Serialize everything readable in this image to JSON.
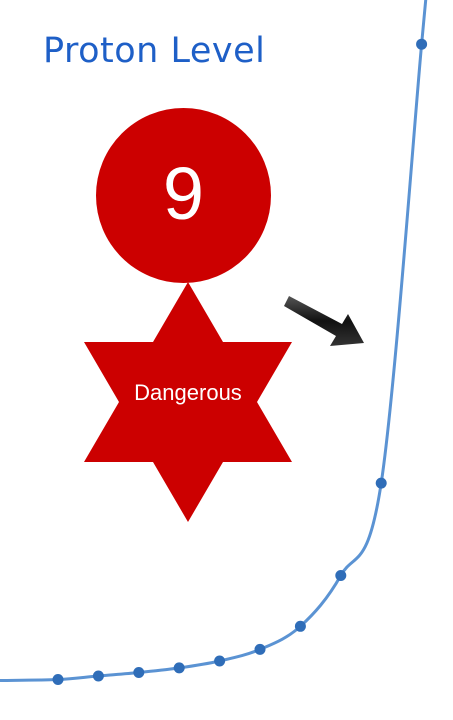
{
  "title": "Proton Level",
  "level": {
    "value": "9",
    "status": "Dangerous"
  },
  "colors": {
    "title": "#1e5fc7",
    "danger": "#cc0000",
    "curve": "#5b93d3",
    "point": "#2f6db8",
    "arrow": "#222222"
  },
  "icons": {
    "status_shape": "six-point-star-icon",
    "pointer": "arrow-icon"
  },
  "chart_data": {
    "type": "line",
    "title": "",
    "xlabel": "",
    "ylabel": "",
    "grid": false,
    "legend": "none",
    "shape": "exponential growth",
    "series": [
      {
        "values": [
          1.0,
          1.3,
          1.6,
          2.0,
          2.6,
          3.6,
          5.6,
          10.0,
          18.0,
          56.0
        ]
      }
    ],
    "ylim": [
      0,
      60
    ]
  }
}
